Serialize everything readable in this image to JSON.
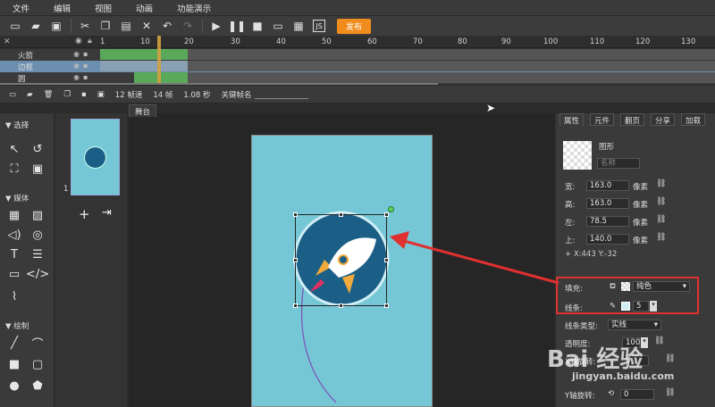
{
  "menu": [
    "文件",
    "编辑",
    "视图",
    "动画",
    "功能演示"
  ],
  "toolbar": {
    "publish_label": "发布"
  },
  "timeline": {
    "ruler_ticks": [
      "1",
      "10",
      "20",
      "30",
      "40",
      "50",
      "60",
      "70",
      "80",
      "90",
      "100",
      "110",
      "120",
      "130"
    ],
    "layers": [
      {
        "name": "火箭"
      },
      {
        "name": "边框"
      },
      {
        "name": "圆"
      }
    ],
    "status": {
      "fps": "12 帧速",
      "frame": "14 帧",
      "time": "1.08 秒",
      "keyframe_label": "关键帧名"
    }
  },
  "left_toolbar": {
    "select_section": "选择",
    "media_section": "媒体",
    "draw_section": "绘制"
  },
  "thumbnails": {
    "page_number": "1"
  },
  "stage": {
    "tab_label": "舞台"
  },
  "properties": {
    "tabs": [
      "属性",
      "元件",
      "翻页",
      "分享",
      "加载"
    ],
    "type_label": "图形",
    "name_placeholder": "名称",
    "width_label": "宽:",
    "width_value": "163.0",
    "height_label": "高:",
    "height_value": "163.0",
    "left_label": "左:",
    "left_value": "78.5",
    "top_label": "上:",
    "top_value": "140.0",
    "unit": "像素",
    "coords": "X:443   Y:-32",
    "fill_label": "填充:",
    "fill_value": "纯色",
    "stroke_label": "线条:",
    "stroke_value": "5",
    "stroke_type_label": "线条类型:",
    "stroke_type_value": "实线",
    "opacity_label": "透明度:",
    "opacity_value": "100",
    "x_rotate_label": "X轴旋转:",
    "x_rotate_value": "0",
    "y_rotate_label": "Y轴旋转:",
    "y_rotate_value": "0"
  },
  "watermark": {
    "brand": "Bai 经验",
    "url": "jingyan.baidu.com"
  },
  "colors": {
    "accent": "#f08c1e",
    "stage_bg": "#75c7d5",
    "circle": "#1b5f86",
    "highlight_red": "#e03030"
  }
}
